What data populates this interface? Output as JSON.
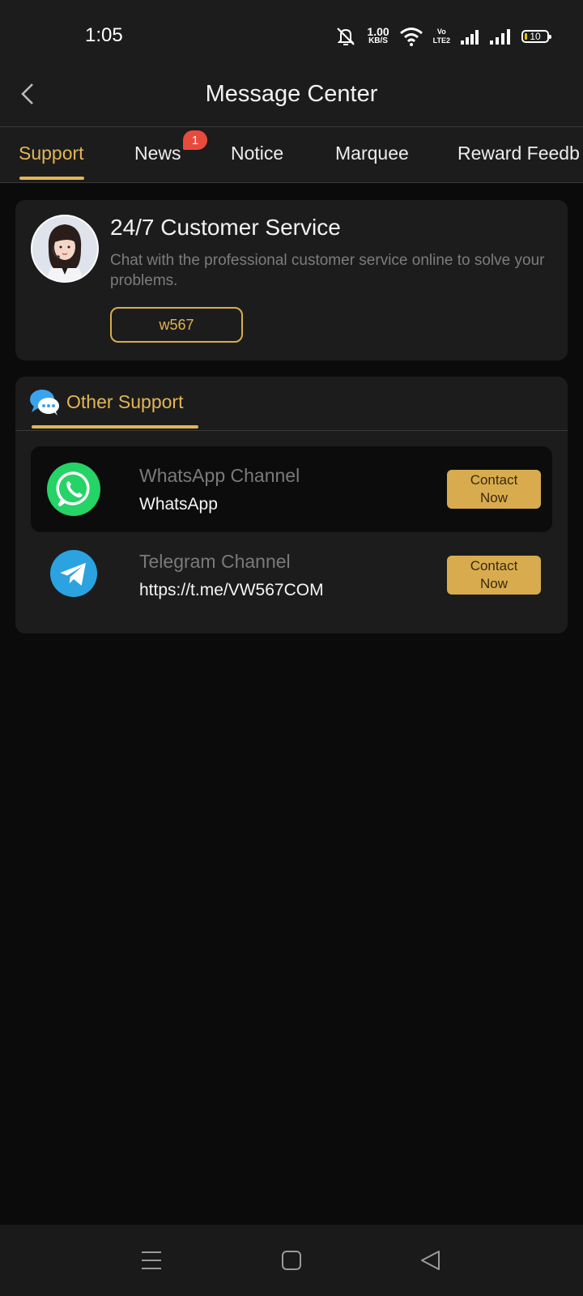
{
  "status_bar": {
    "time": "1:05",
    "net_speed_value": "1.00",
    "net_speed_unit": "KB/S",
    "volte_top": "Vo",
    "volte_bottom": "LTE2",
    "battery": "10"
  },
  "header": {
    "title": "Message Center"
  },
  "tabs": {
    "items": [
      {
        "label": "Support"
      },
      {
        "label": "News",
        "badge": "1"
      },
      {
        "label": "Notice"
      },
      {
        "label": "Marquee"
      },
      {
        "label": "Reward Feedb"
      }
    ],
    "active": "Support"
  },
  "customer_service": {
    "title": "24/7 Customer Service",
    "description": "Chat with the professional customer service online to solve your problems.",
    "button_label": "w567"
  },
  "other_support": {
    "title": "Other Support",
    "channels": [
      {
        "name": "WhatsApp Channel",
        "value": "WhatsApp",
        "button": "Contact\nNow"
      },
      {
        "name": "Telegram Channel",
        "value": "https://t.me/VW567COM",
        "button": "Contact\nNow"
      }
    ]
  },
  "colors": {
    "accent": "#e3b556",
    "background": "#0b0b0b",
    "card": "#1c1c1c",
    "badge": "#e74b3c",
    "whatsapp": "#25d366",
    "telegram": "#2aa3e0"
  },
  "icons": {
    "back": "chevron-left-icon",
    "chat": "chat-bubbles-icon",
    "whatsapp": "whatsapp-icon",
    "telegram": "telegram-icon",
    "nav_menu": "menu-icon",
    "nav_home": "home-square-icon",
    "nav_back": "back-triangle-icon"
  }
}
